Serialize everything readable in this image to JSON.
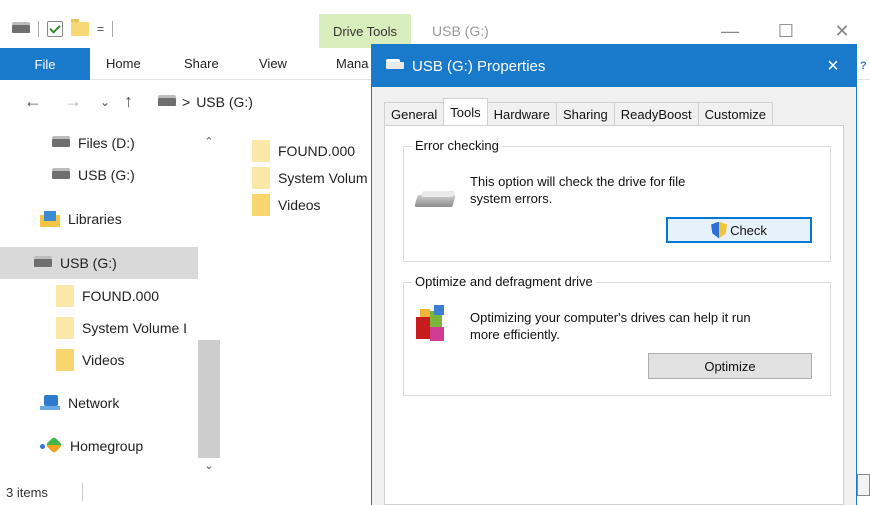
{
  "explorer": {
    "title": "USB (G:)",
    "context_tab": "Drive Tools",
    "ribbon_tabs": [
      "File",
      "Home",
      "Share",
      "View",
      "Mana"
    ],
    "qat_dropdown": "=",
    "address": {
      "separator": ">",
      "location": "USB (G:)"
    },
    "nav_items": [
      {
        "label": "Files (D:)",
        "icon": "drive-icon"
      },
      {
        "label": "USB (G:)",
        "icon": "drive-icon"
      },
      {
        "label": "Libraries",
        "icon": "libraries-icon"
      },
      {
        "label": "USB (G:)",
        "icon": "drive-icon",
        "selected": true
      },
      {
        "label": "FOUND.000",
        "icon": "folder-icon"
      },
      {
        "label": "System Volume I",
        "icon": "folder-icon"
      },
      {
        "label": "Videos",
        "icon": "folder-icon"
      },
      {
        "label": "Network",
        "icon": "network-icon"
      },
      {
        "label": "Homegroup",
        "icon": "homegroup-icon"
      }
    ],
    "files": [
      {
        "name": "FOUND.000"
      },
      {
        "name": "System Volum"
      },
      {
        "name": "Videos"
      }
    ],
    "status": "3 items"
  },
  "dialog": {
    "title": "USB (G:) Properties",
    "close_glyph": "×",
    "tabs": [
      "General",
      "Tools",
      "Hardware",
      "Sharing",
      "ReadyBoost",
      "Customize"
    ],
    "active_tab": "Tools",
    "error_checking": {
      "heading": "Error checking",
      "line1": "This option will check the drive for file",
      "line2": "system errors.",
      "button": "Check"
    },
    "optimize": {
      "heading": "Optimize and defragment drive",
      "line1": "Optimizing your computer's drives can help it run",
      "line2": "more efficiently.",
      "button": "Optimize"
    }
  },
  "colors": {
    "accent": "#1979ca",
    "drive_tools": "#d8efbd",
    "selection": "#d9d9d9"
  }
}
